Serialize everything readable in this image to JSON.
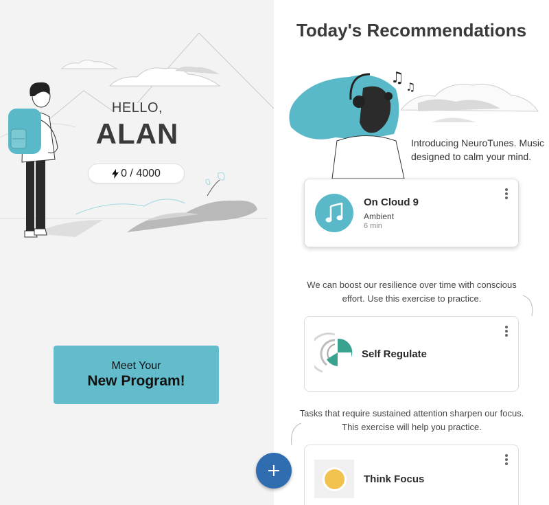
{
  "home": {
    "hello": "HELLO,",
    "name": "ALAN",
    "points": "0 / 4000",
    "program_button": {
      "line1": "Meet Your",
      "line2": "New Program!"
    }
  },
  "recommendations": {
    "title": "Today's Recommendations",
    "intro": "Introducing NeuroTunes. Music designed to calm your mind.",
    "music_card": {
      "title": "On Cloud 9",
      "genre": "Ambient",
      "duration": "6 min"
    },
    "regulate_desc": "We can boost our resilience over time with conscious effort. Use this exercise to practice.",
    "regulate_card": {
      "title": "Self Regulate"
    },
    "focus_desc": "Tasks that require sustained attention sharpen our focus. This exercise will help you practice.",
    "focus_card": {
      "title": "Think Focus"
    }
  },
  "colors": {
    "teal": "#62bccb",
    "fab_blue": "#2f6db0",
    "sun": "#f2c24e"
  },
  "icons": {
    "points": "lightning-bolt-icon",
    "music": "music-note-icon",
    "menu": "kebab-menu-icon",
    "fab": "plus-icon"
  }
}
